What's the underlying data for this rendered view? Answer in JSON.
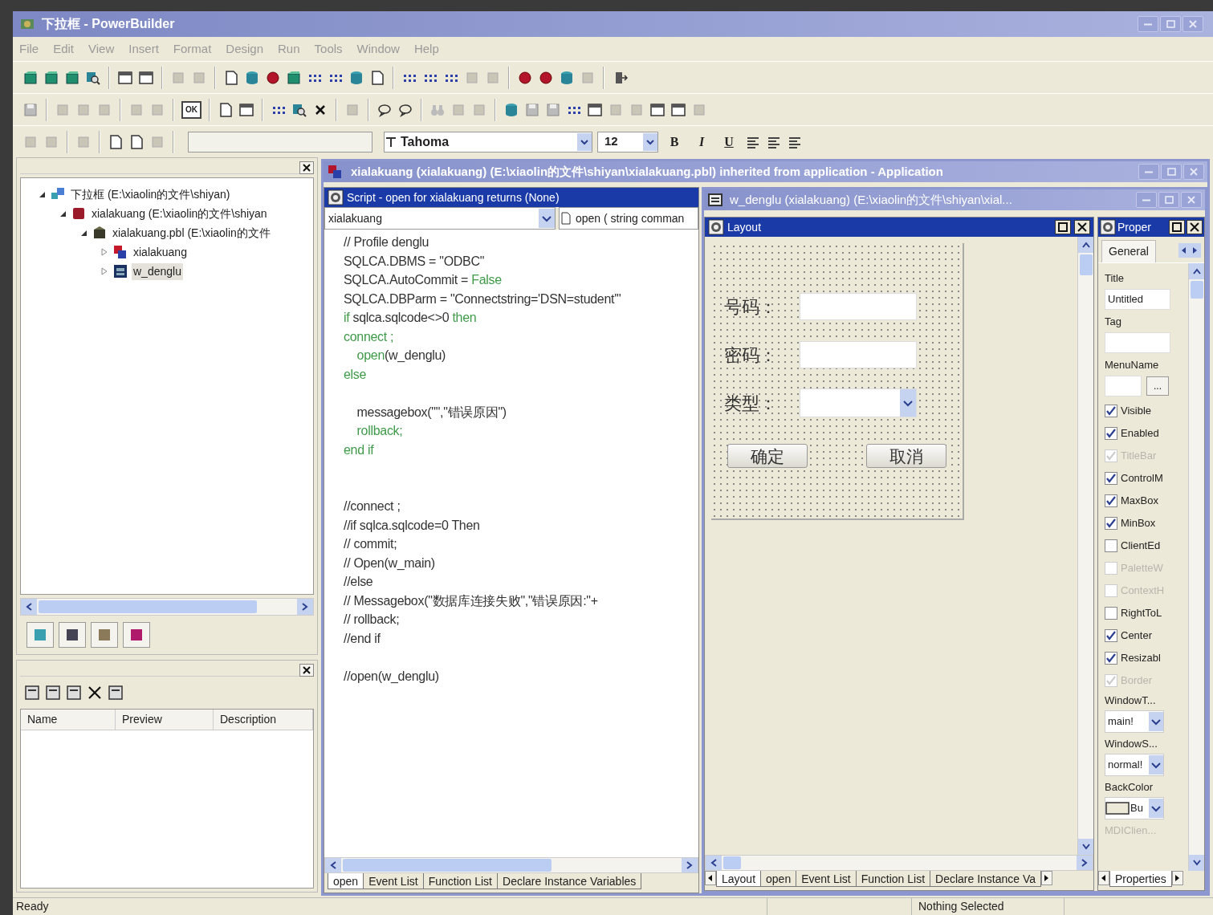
{
  "window": {
    "title": "下拉框 - PowerBuilder"
  },
  "menu": [
    "File",
    "Edit",
    "View",
    "Insert",
    "Format",
    "Design",
    "Run",
    "Tools",
    "Window",
    "Help"
  ],
  "toolbar": {
    "ok_label": "OK",
    "font": "Tahoma",
    "size": "12",
    "bold": "B",
    "italic": "I",
    "underline": "U"
  },
  "tree": [
    {
      "label": "下拉框 (E:\\xiaolin的文件\\shiyan)",
      "expanded": true,
      "selected": false,
      "children": [
        {
          "label": "xialakuang (E:\\xiaolin的文件\\shiyan",
          "expanded": true,
          "selected": false,
          "children": [
            {
              "label": "xialakuang.pbl (E:\\xiaolin的文件",
              "expanded": true,
              "selected": false,
              "children": [
                {
                  "label": "xialakuang",
                  "expanded": false,
                  "selected": false
                },
                {
                  "label": "w_denglu",
                  "expanded": false,
                  "selected": true
                }
              ]
            }
          ]
        }
      ]
    }
  ],
  "library_panel": {
    "columns": [
      "Name",
      "Preview",
      "Description"
    ]
  },
  "app_window": {
    "title": "xialakuang (xialakuang) (E:\\xiaolin的文件\\shiyan\\xialakuang.pbl) inherited from application - Application"
  },
  "script": {
    "title": "Script - open for xialakuang returns (None)",
    "object": "xialakuang",
    "event": "open ( string comman",
    "lines": [
      {
        "kind": "code",
        "segments": [
          {
            "text": "// Profile denglu",
            "kind": "plain"
          }
        ]
      },
      {
        "kind": "code",
        "segments": [
          {
            "text": "SQLCA.DBMS = \"ODBC\"",
            "kind": "plain"
          }
        ]
      },
      {
        "kind": "code",
        "segments": [
          {
            "text": "SQLCA.AutoCommit = ",
            "kind": "plain"
          },
          {
            "text": "False",
            "kind": "keyword"
          }
        ]
      },
      {
        "kind": "code",
        "segments": [
          {
            "text": "SQLCA.DBParm = \"Connectstring='DSN=student'\"",
            "kind": "plain"
          }
        ]
      },
      {
        "kind": "code",
        "segments": [
          {
            "text": "if",
            "kind": "keyword"
          },
          {
            "text": " sqlca.sqlcode<>0 ",
            "kind": "plain"
          },
          {
            "text": "then",
            "kind": "keyword"
          }
        ]
      },
      {
        "kind": "code",
        "segments": [
          {
            "text": "connect ;",
            "kind": "keyword"
          }
        ]
      },
      {
        "kind": "code",
        "segments": [
          {
            "text": "    open",
            "kind": "keyword"
          },
          {
            "text": "(w_denglu)",
            "kind": "plain"
          }
        ]
      },
      {
        "kind": "code",
        "segments": [
          {
            "text": "else",
            "kind": "keyword"
          }
        ]
      },
      {
        "kind": "blank"
      },
      {
        "kind": "code",
        "segments": [
          {
            "text": "    messagebox(\"\",\"错误原因\")",
            "kind": "plain"
          }
        ]
      },
      {
        "kind": "code",
        "segments": [
          {
            "text": "    rollback;",
            "kind": "keyword"
          }
        ]
      },
      {
        "kind": "code",
        "segments": [
          {
            "text": "end if",
            "kind": "keyword"
          }
        ]
      },
      {
        "kind": "blank"
      },
      {
        "kind": "blank"
      },
      {
        "kind": "code",
        "segments": [
          {
            "text": "//connect ;",
            "kind": "plain"
          }
        ]
      },
      {
        "kind": "code",
        "segments": [
          {
            "text": "//if sqlca.sqlcode=0 Then",
            "kind": "plain"
          }
        ]
      },
      {
        "kind": "code",
        "segments": [
          {
            "text": "// commit;",
            "kind": "plain"
          }
        ]
      },
      {
        "kind": "code",
        "segments": [
          {
            "text": "// Open(w_main)",
            "kind": "plain"
          }
        ]
      },
      {
        "kind": "code",
        "segments": [
          {
            "text": "//else",
            "kind": "plain"
          }
        ]
      },
      {
        "kind": "code",
        "segments": [
          {
            "text": "// Messagebox(\"数据库连接失败\",\"错误原因:\"+",
            "kind": "plain"
          }
        ]
      },
      {
        "kind": "code",
        "segments": [
          {
            "text": "// rollback;",
            "kind": "plain"
          }
        ]
      },
      {
        "kind": "code",
        "segments": [
          {
            "text": "//end if",
            "kind": "plain"
          }
        ]
      },
      {
        "kind": "blank"
      },
      {
        "kind": "code",
        "segments": [
          {
            "text": "//open(w_denglu)",
            "kind": "plain"
          }
        ]
      }
    ],
    "tabs": [
      {
        "label": "open",
        "selected": true
      },
      {
        "label": "Event List",
        "selected": false
      },
      {
        "label": "Function List",
        "selected": false
      },
      {
        "label": "Declare Instance Variables",
        "selected": false
      }
    ]
  },
  "design_window": {
    "title": "w_denglu (xialakuang) (E:\\xiaolin的文件\\shiyan\\xial..."
  },
  "layout": {
    "title": "Layout",
    "fields": [
      {
        "label": "号码：",
        "kind": "text"
      },
      {
        "label": "密码：",
        "kind": "text"
      },
      {
        "label": "类型：",
        "kind": "dropdown"
      }
    ],
    "buttons": [
      "确定",
      "取消"
    ],
    "tabs": [
      {
        "label": "Layout",
        "selected": true
      },
      {
        "label": "open",
        "selected": false
      },
      {
        "label": "Event List",
        "selected": false
      },
      {
        "label": "Function List",
        "selected": false
      },
      {
        "label": "Declare Instance Va",
        "selected": false
      }
    ]
  },
  "properties": {
    "title": "Proper",
    "tabs": [
      {
        "label": "General",
        "selected": true
      }
    ],
    "items": [
      {
        "kind": "field",
        "label": "Title",
        "value": "Untitled",
        "disabled": false
      },
      {
        "kind": "field",
        "label": "Tag",
        "disabled": false
      },
      {
        "kind": "field-button",
        "label": "MenuName",
        "button": "...",
        "disabled": false
      },
      {
        "kind": "checkbox",
        "label": "Visible",
        "checked": true,
        "disabled": false
      },
      {
        "kind": "checkbox",
        "label": "Enabled",
        "checked": true,
        "disabled": false
      },
      {
        "kind": "checkbox",
        "label": "TitleBar",
        "checked": true,
        "disabled": true
      },
      {
        "kind": "checkbox",
        "label": "ControlM",
        "checked": true,
        "disabled": false
      },
      {
        "kind": "checkbox",
        "label": "MaxBox",
        "checked": true,
        "disabled": false
      },
      {
        "kind": "checkbox",
        "label": "MinBox",
        "checked": true,
        "disabled": false
      },
      {
        "kind": "checkbox",
        "label": "ClientEd",
        "checked": false,
        "disabled": false
      },
      {
        "kind": "checkbox",
        "label": "PaletteW",
        "checked": false,
        "disabled": true
      },
      {
        "kind": "checkbox",
        "label": "ContextH",
        "checked": false,
        "disabled": true
      },
      {
        "kind": "checkbox",
        "label": "RightToL",
        "checked": false,
        "disabled": false
      },
      {
        "kind": "checkbox",
        "label": "Center",
        "checked": true,
        "disabled": false
      },
      {
        "kind": "checkbox",
        "label": "Resizabl",
        "checked": true,
        "disabled": false
      },
      {
        "kind": "checkbox",
        "label": "Border",
        "checked": true,
        "disabled": true
      },
      {
        "kind": "dropdown",
        "label": "WindowT...",
        "value": "main!",
        "disabled": false
      },
      {
        "kind": "dropdown",
        "label": "WindowS...",
        "value": "normal!",
        "disabled": false
      },
      {
        "kind": "color-dropdown",
        "label": "BackColor",
        "value": "Bu",
        "disabled": false
      },
      {
        "kind": "label",
        "label": "MDIClien...",
        "disabled": true
      }
    ],
    "bottom_tabs": [
      {
        "label": "Properties",
        "selected": true
      }
    ]
  },
  "status_bar": {
    "message": "Ready",
    "selection": "Nothing Selected"
  }
}
